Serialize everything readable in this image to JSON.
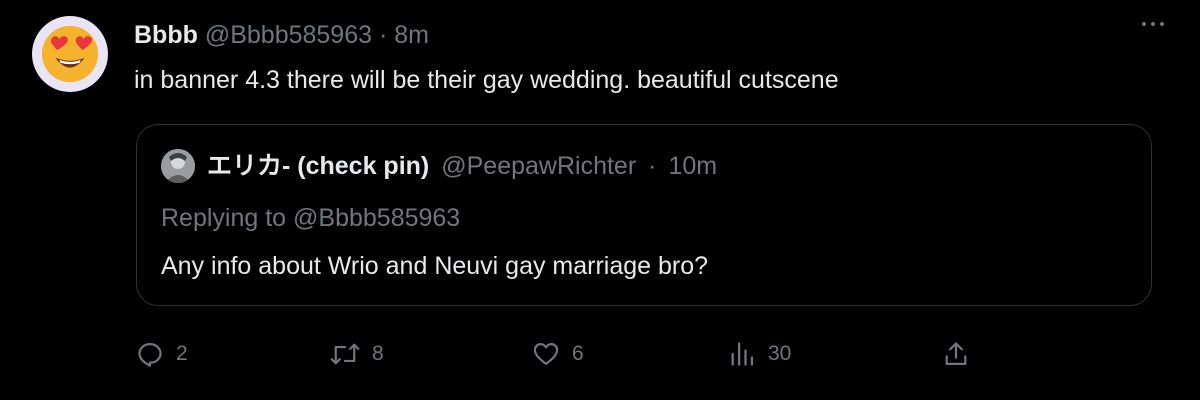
{
  "tweet": {
    "display_name": "Bbbb",
    "handle": "@Bbbb585963",
    "separator": "·",
    "time": "8m",
    "text": "in banner 4.3 there will be their gay wedding. beautiful cutscene",
    "avatar_icon": "heart-eyes-emoji"
  },
  "quote": {
    "display_name": "エリカ- (check pin)",
    "handle": "@PeepawRichter",
    "separator": "·",
    "time": "10m",
    "replying_to": "Replying to @Bbbb585963",
    "text": "Any info about Wrio and Neuvi gay marriage bro?"
  },
  "actions": {
    "replies": "2",
    "retweets": "8",
    "likes": "6",
    "views": "30"
  },
  "colors": {
    "background": "#000000",
    "text": "#e7e9ea",
    "muted": "#71767b",
    "border": "#2f3336"
  }
}
